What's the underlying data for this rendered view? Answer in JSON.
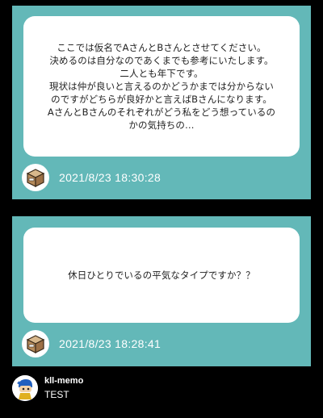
{
  "posts": [
    {
      "lines": [
        "ここでは仮名でAさんとBさんとさせてください。",
        "決めるのは自分なのであくまでも参考にいたします。",
        "二人とも年下です。",
        "現状は仲が良いと言えるのかどうかまでは分からない",
        "のですがどちらが良好かと言えばBさんになります。",
        "AさんとBさんのそれぞれがどう私をどう想っているの",
        "かの気持ちの…"
      ],
      "avatar_icon": "box-icon",
      "timestamp": "2021/8/23 18:30:28"
    },
    {
      "lines": [
        "休日ひとりでいるの平気なタイプですか？？"
      ],
      "avatar_icon": "box-icon",
      "timestamp": "2021/8/23 18:28:41"
    }
  ],
  "footer": {
    "username": "kll-memo",
    "text": "TEST",
    "avatar_icon": "character-avatar-icon"
  },
  "colors": {
    "background": "#000000",
    "card": "#63b8b8",
    "bubble": "#ffffff",
    "text": "#222222"
  }
}
